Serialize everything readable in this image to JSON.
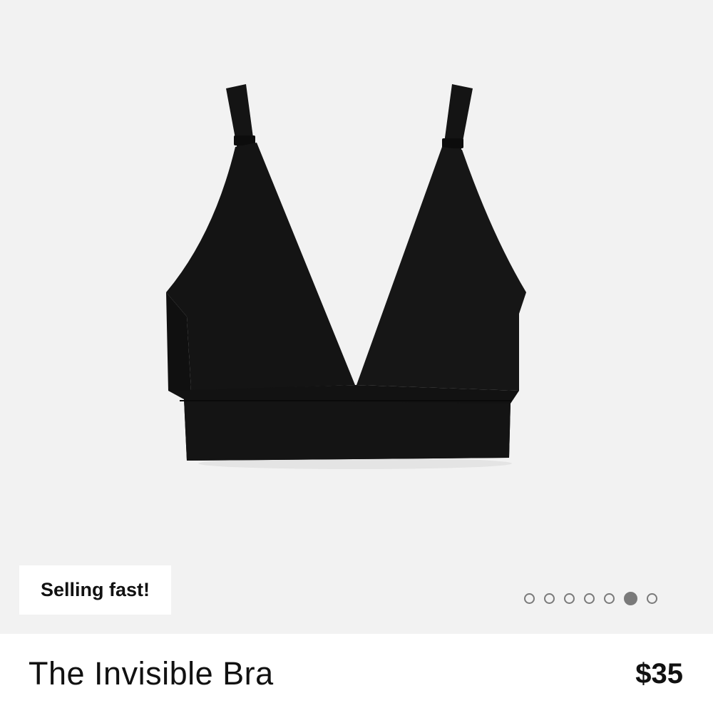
{
  "product": {
    "badge": "Selling fast!",
    "name": "The Invisible Bra",
    "price": "$35",
    "image_alt": "black bra",
    "carousel": {
      "total": 7,
      "active_index": 5
    }
  },
  "colors": {
    "image_background": "#f2f2f2",
    "garment": "#141414",
    "dot": "#7a7a7a",
    "text": "#111111"
  }
}
